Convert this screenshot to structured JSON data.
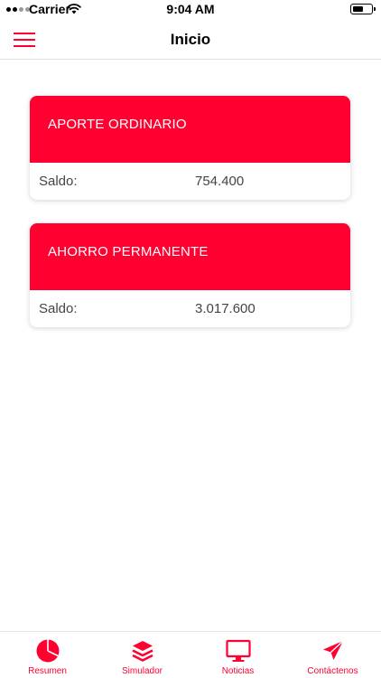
{
  "status_bar": {
    "carrier": "Carrier",
    "time": "9:04 AM"
  },
  "nav": {
    "title": "Inicio",
    "menu_icon": "hamburger-menu-icon"
  },
  "cards": [
    {
      "title": "APORTE ORDINARIO",
      "label": "Saldo:",
      "value": "754.400"
    },
    {
      "title": "AHORRO PERMANENTE",
      "label": "Saldo:",
      "value": "3.017.600"
    }
  ],
  "tabs": [
    {
      "label": "Resumen",
      "icon": "pie-chart-icon"
    },
    {
      "label": "Simulador",
      "icon": "layers-icon"
    },
    {
      "label": "Noticias",
      "icon": "monitor-icon"
    },
    {
      "label": "Contáctenos",
      "icon": "paper-plane-icon"
    }
  ],
  "colors": {
    "accent": "#ff0030"
  }
}
